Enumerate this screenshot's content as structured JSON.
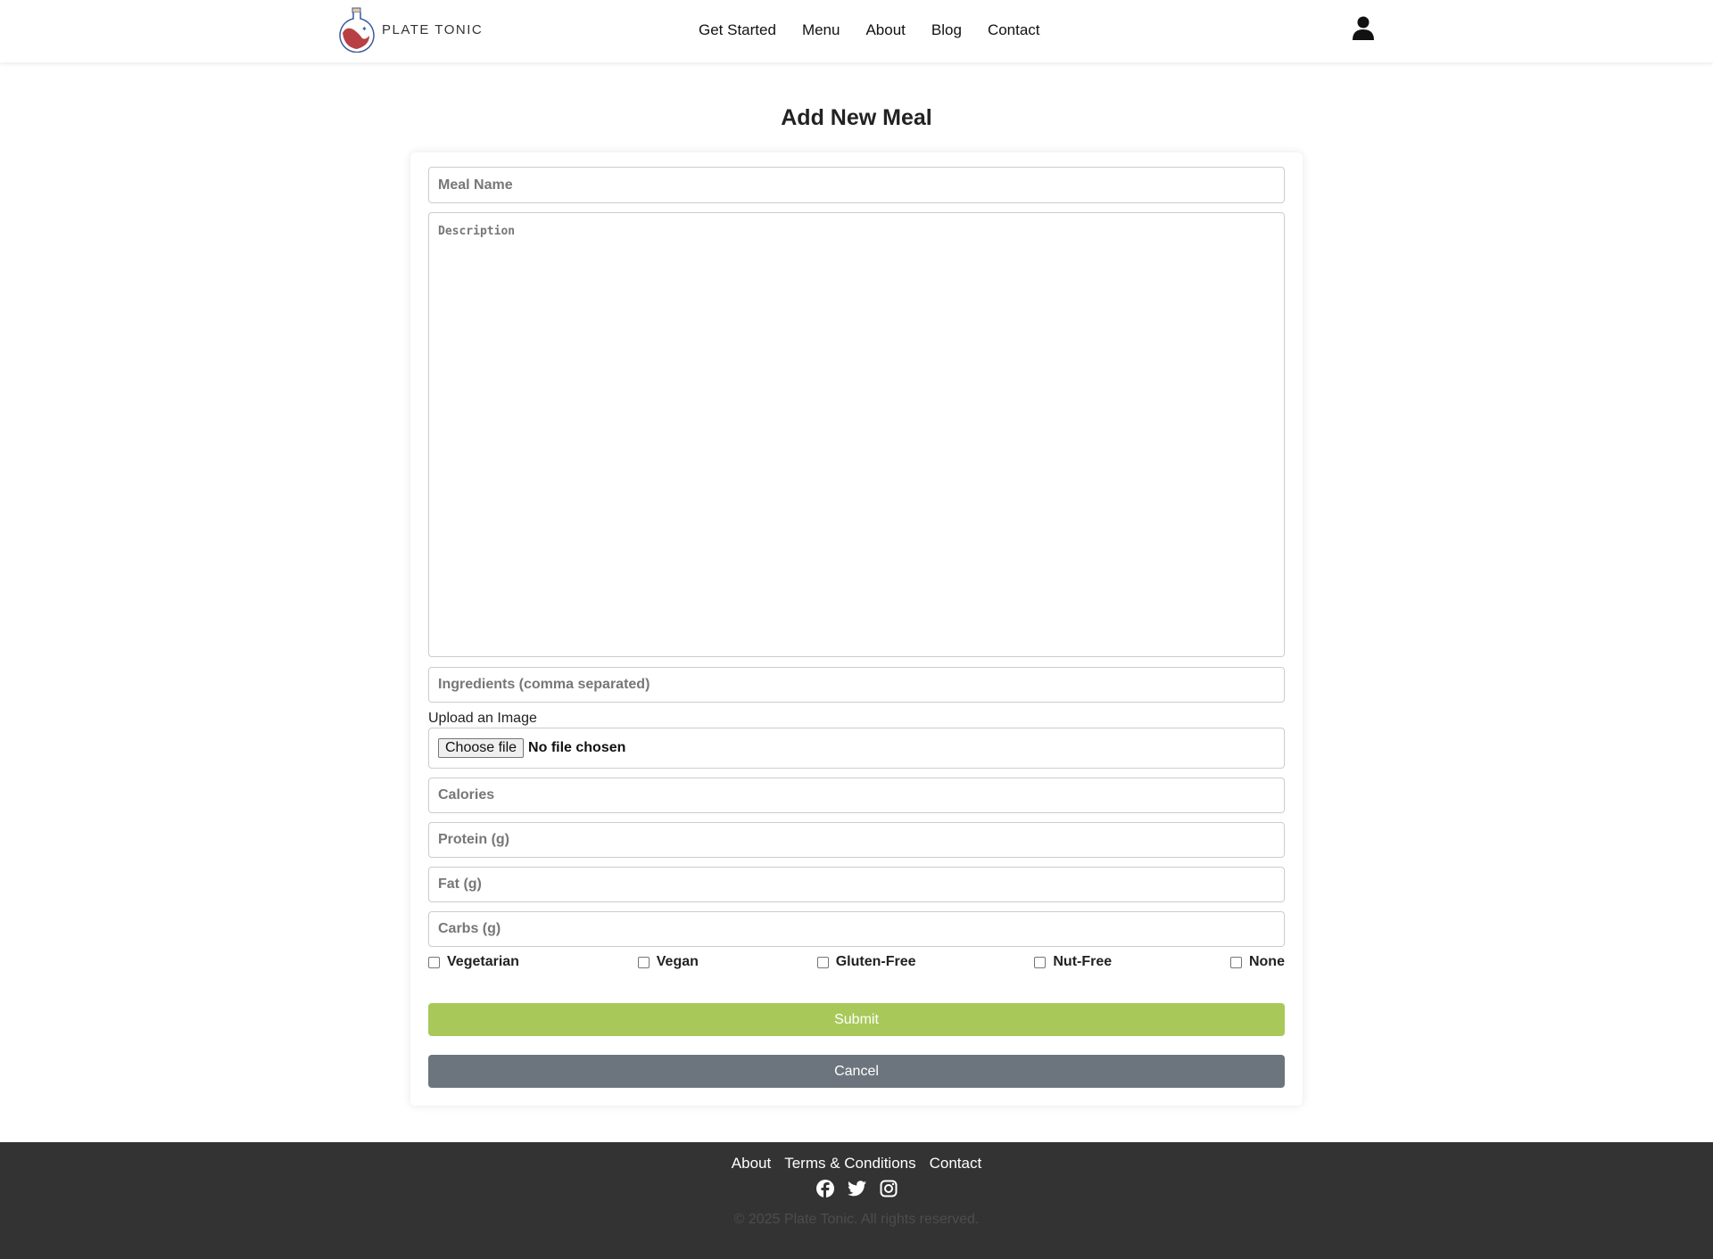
{
  "brand": {
    "name": "PLATE TONIC"
  },
  "nav": [
    "Get Started",
    "Menu",
    "About",
    "Blog",
    "Contact"
  ],
  "page": {
    "title": "Add New Meal"
  },
  "form": {
    "meal_name": {
      "placeholder": "Meal Name",
      "value": ""
    },
    "description": {
      "placeholder": "Description",
      "value": ""
    },
    "ingredients": {
      "placeholder": "Ingredients (comma separated)",
      "value": ""
    },
    "upload_label": "Upload an Image",
    "file_button": "Choose file",
    "file_status": "No file chosen",
    "calories": {
      "placeholder": "Calories"
    },
    "protein": {
      "placeholder": "Protein (g)"
    },
    "fat": {
      "placeholder": "Fat (g)"
    },
    "carbs": {
      "placeholder": "Carbs (g)"
    },
    "diet_options": [
      {
        "label": "Vegetarian",
        "checked": false
      },
      {
        "label": "Vegan",
        "checked": false
      },
      {
        "label": "Gluten-Free",
        "checked": false
      },
      {
        "label": "Nut-Free",
        "checked": false
      },
      {
        "label": "None",
        "checked": false
      }
    ],
    "submit": "Submit",
    "cancel": "Cancel"
  },
  "footer": {
    "links": [
      "About",
      "Terms & Conditions",
      "Contact"
    ],
    "social_icons": [
      "facebook-icon",
      "twitter-icon",
      "instagram-icon"
    ],
    "copyright": "© 2025 Plate Tonic. All rights reserved."
  },
  "colors": {
    "submit": "#a8c95a",
    "cancel": "#6c757d",
    "footer": "#333333",
    "logo_red": "#b84045",
    "logo_blue": "#3a5a9a"
  }
}
